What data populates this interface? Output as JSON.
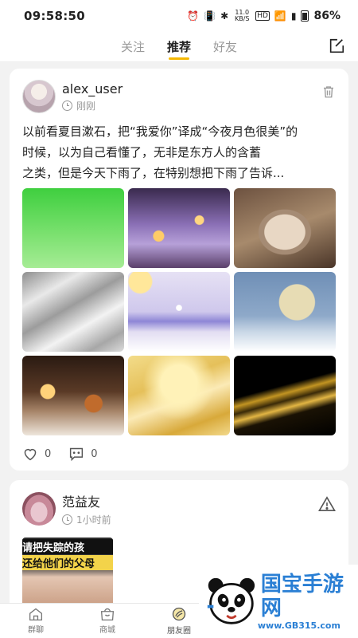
{
  "status_bar": {
    "time": "09:58:50",
    "signal_text": "11.0 KB/S",
    "hd_label": "HD",
    "battery": "86%"
  },
  "top_nav": {
    "tabs": [
      {
        "label": "关注",
        "active": false
      },
      {
        "label": "推荐",
        "active": true
      },
      {
        "label": "好友",
        "active": false
      }
    ],
    "compose_icon": "compose-icon"
  },
  "posts": [
    {
      "username": "alex_user",
      "time": "刚刚",
      "action_icon": "trash-icon",
      "text_lines": [
        "以前看夏目漱石，把“我爱你”译成“今夜月色很美”的",
        "时候，以为自己看懂了，无非是东方人的含蓄",
        "之类，但是今天下雨了，在特别想把下雨了告诉..."
      ],
      "image_count": 9,
      "likes": "0",
      "comments": "0"
    },
    {
      "username": "范益友",
      "time": "1小时前",
      "action_icon": "warning-icon",
      "video_caption_1": "请把失踪的孩",
      "video_caption_2": "还给他们的父母"
    }
  ],
  "bottom_nav": [
    {
      "label": "群聊",
      "icon": "home-icon"
    },
    {
      "label": "商城",
      "icon": "shop-bag-icon"
    },
    {
      "label": "朋友圈",
      "icon": "moments-icon"
    }
  ],
  "watermark": {
    "title": "国宝手游网",
    "url": "www.GB315.com"
  },
  "colors": {
    "accent": "#f5b800",
    "watermark_blue": "#2a7fd4"
  }
}
